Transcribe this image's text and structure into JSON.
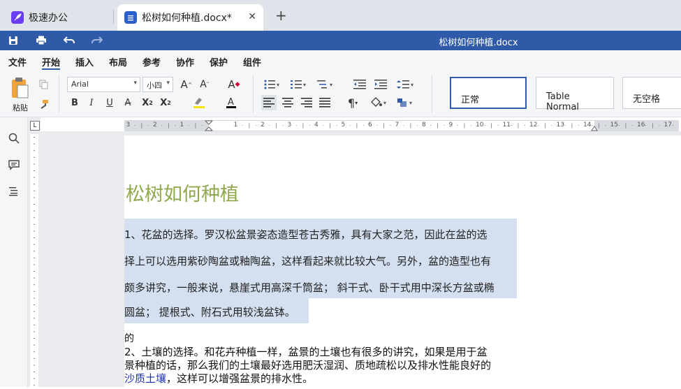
{
  "tabs": [
    {
      "label": "极速办公",
      "active": false
    },
    {
      "label": "松树如何种植.docx*",
      "active": true
    }
  ],
  "new_tab_label": "+",
  "window_title": "松树如何种植.docx",
  "menu": [
    "文件",
    "开始",
    "插入",
    "布局",
    "参考",
    "协作",
    "保护",
    "组件"
  ],
  "ribbon": {
    "paste_label": "粘贴",
    "font_name": "Arial",
    "font_size": "小四",
    "styles": [
      "正常",
      "Table Normal",
      "无空格"
    ]
  },
  "ruler": {
    "labels": [
      "3",
      "2",
      "1",
      "1",
      "2",
      "3",
      "4",
      "5",
      "6",
      "7",
      "8",
      "9",
      "10",
      "11",
      "12",
      "13",
      "14",
      "15",
      "16",
      "17"
    ]
  },
  "document": {
    "heading": "松树如何种植",
    "para1_lines": [
      "1、花盆的选择。罗汉松盆景姿态造型苍古秀雅，具有大家之范，因此在盆的选",
      "择上可以选用紫砂陶盆或釉陶盆，这样看起来就比较大气。另外，盆的造型也有",
      "颇多讲究，一般来说，悬崖式用高深千筒盆；  斜干式、卧干式用中深长方盆或椭",
      "圆盆；  提根式、附石式用较浅盆钵。"
    ],
    "fragment": "的",
    "para2_line1": "2、土壤的选择。和花卉种植一样，盆景的土壤也有很多的讲究，如果是用于盆",
    "para2_line2": "景种植的话，那么我们的土壤最好选用肥沃湿润、质地疏松以及排水性能良好的",
    "para2_link": "沙质土壤",
    "para2_line3_rest": "，这样可以增强盆景的排水性。"
  },
  "colors": {
    "accent": "#2e5aa8",
    "heading": "#8faa4e",
    "selection": "#d4dff0",
    "link": "#1b2fb8"
  }
}
